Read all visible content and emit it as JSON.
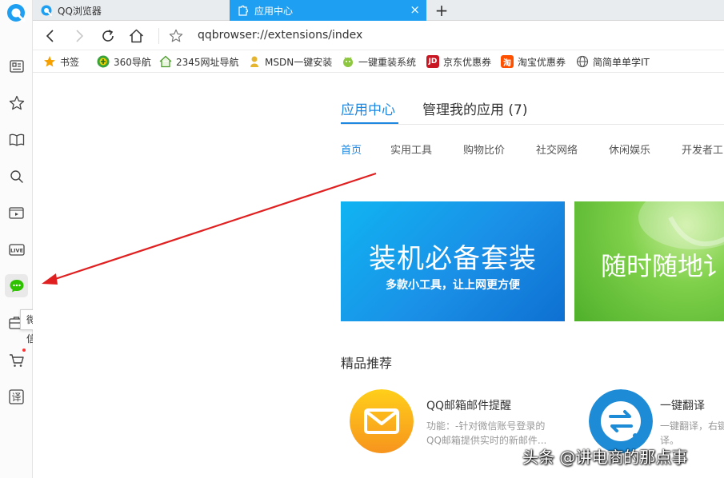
{
  "tabs": [
    {
      "title": "QQ浏览器",
      "active": false
    },
    {
      "title": "应用中心",
      "active": true,
      "close": "×"
    }
  ],
  "new_tab": "+",
  "address": {
    "url": "qqbrowser://extensions/index"
  },
  "bookmarks": [
    {
      "label": "书签",
      "icon": "star-icon"
    },
    {
      "label": "360导航",
      "icon": "360-icon"
    },
    {
      "label": "2345网址导航",
      "icon": "house-icon"
    },
    {
      "label": "MSDN一键安装",
      "icon": "msdn-icon"
    },
    {
      "label": "一键重装系统",
      "icon": "reinstall-icon"
    },
    {
      "label": "京东优惠券",
      "icon_text": "JD"
    },
    {
      "label": "淘宝优惠券",
      "icon_text": "淘"
    },
    {
      "label": "简简单单学IT",
      "icon": "globe-icon"
    }
  ],
  "sidebar": {
    "tooltip": "微信",
    "active_item": "wechat"
  },
  "main": {
    "tabs": [
      {
        "label": "应用中心",
        "active": true
      },
      {
        "label": "管理我的应用 (7)",
        "active": false
      }
    ],
    "categories": [
      "首页",
      "实用工具",
      "购物比价",
      "社交网络",
      "休闲娱乐",
      "开发者工"
    ],
    "banners": [
      {
        "title": "装机必备套装",
        "subtitle": "多款小工具，让上网更方便"
      },
      {
        "title": "随时随地讠"
      }
    ],
    "section_title": "精品推荐",
    "apps": [
      {
        "name": "QQ邮箱邮件提醒",
        "desc1": "功能：-针对微信账号登录的",
        "desc2": "QQ邮箱提供实时的新邮件..."
      },
      {
        "name": "一键翻译",
        "desc1": "一键翻译，右键",
        "desc2": "译。"
      }
    ]
  },
  "watermark": "头条 @讲电商的那点事",
  "colors": {
    "accent": "#1e87e0",
    "tab_active": "#1e9ff2",
    "arrow": "#e02020",
    "wechat": "#2dc100"
  }
}
